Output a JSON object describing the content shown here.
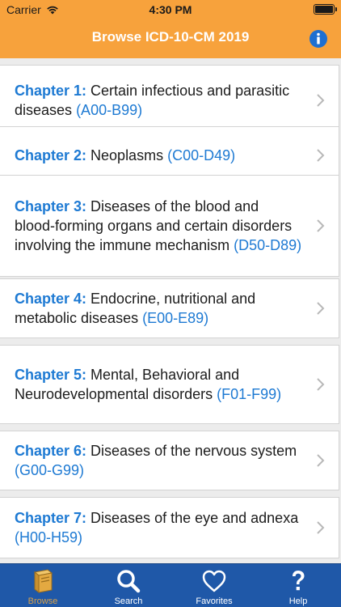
{
  "status_bar": {
    "carrier": "Carrier",
    "time": "4:30 PM"
  },
  "nav": {
    "title": "Browse ICD-10-CM 2019",
    "info_icon": "info-icon"
  },
  "chapters": [
    {
      "label": "Chapter 1:",
      "title": "Certain infectious and parasitic diseases",
      "code": "(A00-B99)"
    },
    {
      "label": "Chapter 2:",
      "title": "Neoplasms",
      "code": "(C00-D49)"
    },
    {
      "label": "Chapter 3:",
      "title": "Diseases of the blood and blood-forming organs and certain disorders involving the immune mechanism",
      "code": "(D50-D89)"
    },
    {
      "label": "Chapter 4:",
      "title": "Endocrine, nutritional and metabolic diseases",
      "code": "(E00-E89)"
    },
    {
      "label": "Chapter 5:",
      "title": "Mental, Behavioral and Neurodevelopmental disorders",
      "code": "(F01-F99)"
    },
    {
      "label": "Chapter 6:",
      "title": "Diseases of the nervous system",
      "code": "(G00-G99)"
    },
    {
      "label": "Chapter 7:",
      "title": "Diseases of the eye and adnexa",
      "code": "(H00-H59)"
    }
  ],
  "tabs": [
    {
      "label": "Browse",
      "icon": "book-icon",
      "active": true
    },
    {
      "label": "Search",
      "icon": "search-icon",
      "active": false
    },
    {
      "label": "Favorites",
      "icon": "heart-icon",
      "active": false
    },
    {
      "label": "Help",
      "icon": "question-mark-icon",
      "active": false
    }
  ],
  "colors": {
    "header": "#f7a23c",
    "tabbar": "#1f58a8",
    "link": "#1e7ad3",
    "active_tab": "#d8a14a"
  }
}
